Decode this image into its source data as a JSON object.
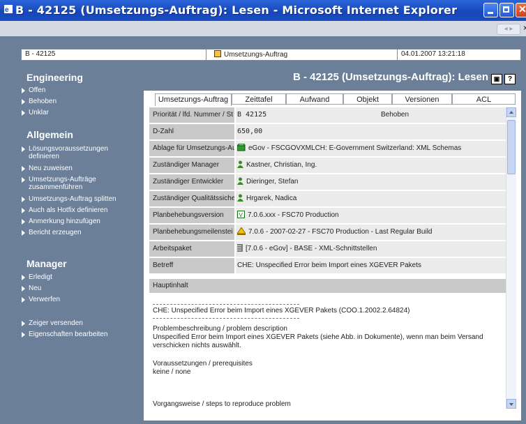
{
  "window": {
    "title": "B - 42125 (Umsetzungs-Auftrag): Lesen - Microsoft Internet Explorer"
  },
  "infobar": {
    "id": "B - 42125",
    "type": "Umsetzungs-Auftrag",
    "datetime": "04.01.2007 13:21:18"
  },
  "sidebar": {
    "engineering": {
      "heading": "Engineering",
      "items": [
        "Offen",
        "Behoben",
        "Unklar"
      ]
    },
    "allgemein": {
      "heading": "Allgemein",
      "items": [
        "Lösungsvoraussetzungen definieren",
        "Neu zuweisen",
        "Umsetzungs-Aufträge zusammenführen",
        "Umsetzungs-Auftrag splitten",
        "Auch als Hotfix definieren",
        "Anmerkung hinzufügen",
        "Bericht erzeugen"
      ]
    },
    "manager": {
      "heading": "Manager",
      "items": [
        "Erledigt",
        "Neu",
        "Verwerfen"
      ]
    },
    "extra": [
      "Zeiger versenden",
      "Eigenschaften bearbeiten"
    ]
  },
  "page_title": "B - 42125 (Umsetzungs-Auftrag): Lesen",
  "tabs": [
    "Umsetzungs-Auftrag",
    "Zeittafel",
    "Aufwand",
    "Objekt",
    "Versionen",
    "ACL"
  ],
  "fields": [
    {
      "label": "Priorität / lfd. Nummer / St",
      "value": "B     42125",
      "status": "Behoben"
    },
    {
      "label": "D-Zahl",
      "value": "650,00"
    },
    {
      "label": "Ablage für Umsetzungs-Au",
      "value": "eGov - FSCGOVXMLCH: E-Government Switzerland: XML Schemas"
    },
    {
      "label": "Zuständiger Manager",
      "value": "Kastner, Christian, Ing."
    },
    {
      "label": "Zuständiger Entwickler",
      "value": "Dieringer, Stefan"
    },
    {
      "label": "Zuständiger Qualitätssiche",
      "value": "Hrgarek, Nadica"
    },
    {
      "label": "Planbehebungsversion",
      "value": "7.0.6.xxx - FSC70 Production"
    },
    {
      "label": "Planbehebungsmeilenstei",
      "value": "7.0.6 - 2007-02-27 - FSC70 Production - Last Regular Build"
    },
    {
      "label": "Arbeitspaket",
      "value": "[7.0.6 - eGov] - BASE - XML-Schnittstellen"
    },
    {
      "label": "Betreff",
      "value": "CHE: Unspecified Error beim Import eines XGEVER Pakets"
    }
  ],
  "hauptinhalt": {
    "label": "Hauptinhalt",
    "lines": [
      "CHE: Unspecified Error beim Import eines XGEVER Pakets (COO.1.2002.2.64824)",
      "Problembeschreibung / problem description",
      "Unspecified Error beim Import eines XGEVER Pakets (siehe Abb. in Dokumente), wenn man beim Versand",
      "verschicken nichts auswählt.",
      "Voraussetzungen / prerequisites",
      "keine / none",
      "Vorgangsweise / steps to reproduce problem"
    ]
  },
  "colors": {
    "titlebar": "#1747b8",
    "background": "#6b7f98",
    "label_bg": "#c9c9c9",
    "value_bg": "#ebebeb"
  }
}
